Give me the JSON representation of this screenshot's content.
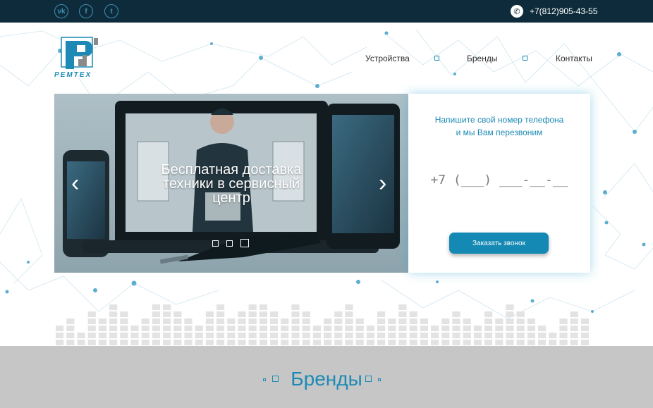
{
  "topbar": {
    "social": [
      {
        "name": "vk",
        "glyph": "vk"
      },
      {
        "name": "facebook",
        "glyph": "f"
      },
      {
        "name": "twitter",
        "glyph": "t"
      }
    ],
    "phone": "+7(812)905-43-55"
  },
  "logo": {
    "text": "РЕМТЕХ"
  },
  "nav": {
    "items": [
      "Устройства",
      "Бренды",
      "Контакты"
    ]
  },
  "slider": {
    "caption_lines": [
      "Бесплатная доставка",
      "техники в сервисный",
      "центр"
    ],
    "prev": "‹",
    "next": "›",
    "slide_count": 3,
    "active_slide": 3
  },
  "callback": {
    "title_line1": "Напишите свой номер телефона",
    "title_line2": "и мы Вам перезвоним",
    "phone_placeholder": "+7 (___) ___-__-__",
    "button": "Заказать звонок"
  },
  "brands": {
    "title": "Бренды"
  },
  "colors": {
    "topbar": "#0d2b3a",
    "accent": "#1d8ab5",
    "button": "#1389b4",
    "brands_bg": "#c6c6c6"
  }
}
